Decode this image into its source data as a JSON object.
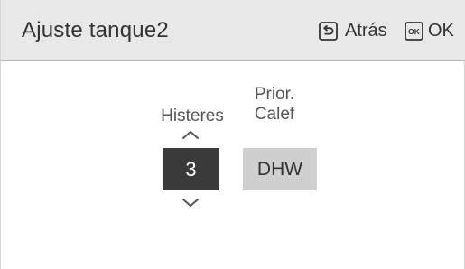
{
  "header": {
    "title": "Ajuste tanque2",
    "back_label": "Atrás",
    "ok_label": "OK",
    "ok_icon_text": "OK"
  },
  "settings": {
    "hysteresis": {
      "label": "Histeres",
      "value": "3"
    },
    "priority": {
      "label_line1": "Prior.",
      "label_line2": "Calef",
      "value": "DHW"
    }
  },
  "icons": {
    "back": "back-return-icon",
    "ok": "ok-key-icon",
    "increase": "chevron-up-icon",
    "decrease": "chevron-down-icon"
  },
  "colors": {
    "header_bg": "#e8e8e8",
    "selected_value_bg": "#3a3a3a",
    "option_bg": "#cfcfcf",
    "text": "#333333"
  }
}
